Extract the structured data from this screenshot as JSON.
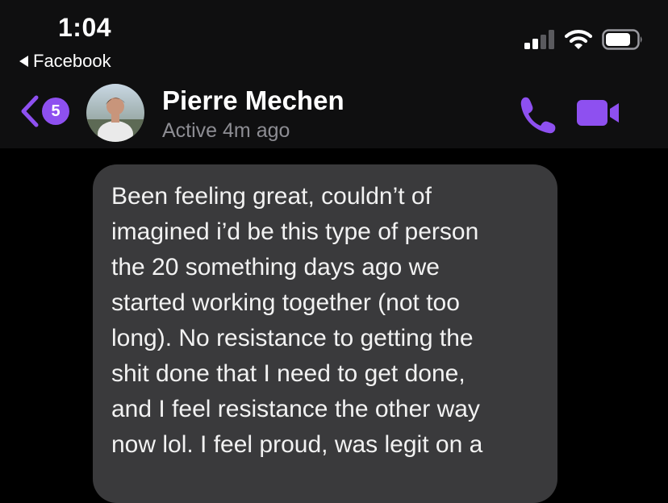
{
  "status_bar": {
    "time": "1:04",
    "back_app_label": "Facebook",
    "signal_icon": "cellular-signal-icon",
    "wifi_icon": "wifi-icon",
    "battery_icon": "battery-icon"
  },
  "conversation_header": {
    "unread_count": "5",
    "contact_name": "Pierre Mechen",
    "active_status": "Active 4m ago",
    "accent_color": "#8e50f0",
    "call_icon": "phone-icon",
    "video_icon": "video-camera-icon"
  },
  "messages": [
    {
      "text": "Been feeling great, couldn’t of\nimagined i’d be this type of person\nthe 20 something days ago we\nstarted working together (not too\nlong). No resistance to getting the\nshit done that I need to get done,\nand I feel resistance the other way\nnow lol. I feel proud, was legit on a"
    }
  ]
}
